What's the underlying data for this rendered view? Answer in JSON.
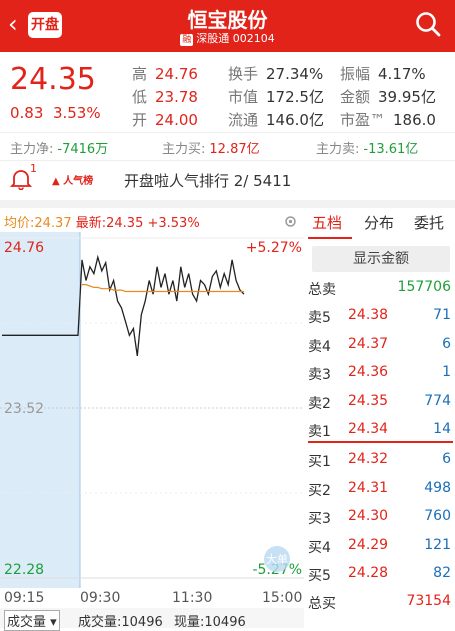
{
  "header": {
    "back": "‹",
    "logo": "开盘",
    "title": "恒宝股份",
    "tag": "融",
    "board": "深股通",
    "code": "002104"
  },
  "quote": {
    "price": "24.35",
    "change": "0.83",
    "change_pct": "3.53%"
  },
  "stats": [
    {
      "label": "高",
      "value": "24.76",
      "color": "#e2231a"
    },
    {
      "label": "换手",
      "value": "27.34%",
      "color": "#333333"
    },
    {
      "label": "振幅",
      "value": "4.17%",
      "color": "#333333"
    },
    {
      "label": "低",
      "value": "23.78",
      "color": "#e2231a"
    },
    {
      "label": "市值",
      "value": "172.5亿",
      "color": "#333333"
    },
    {
      "label": "金额",
      "value": "39.95亿",
      "color": "#333333"
    },
    {
      "label": "开",
      "value": "24.00",
      "color": "#e2231a"
    },
    {
      "label": "流通",
      "value": "146.0亿",
      "color": "#333333"
    },
    {
      "label": "市盈™",
      "value": "186.0",
      "color": "#333333"
    }
  ],
  "flow": [
    {
      "label": "主力净:",
      "value": "-7416万",
      "color": "#1e9f3a"
    },
    {
      "label": "主力买:",
      "value": "12.87亿",
      "color": "#e2231a"
    },
    {
      "label": "主力卖:",
      "value": "-13.61亿",
      "color": "#1e9f3a"
    }
  ],
  "notify": {
    "count": "1",
    "rank_icon": "人气榜",
    "rank_text": "开盘啦人气排行 2/ 5411"
  },
  "chart": {
    "avg_label": "均价:24.37",
    "latest_label": "最新:24.35 +3.53%",
    "y_top": "24.76",
    "y_mid": "23.52",
    "y_bot": "22.28",
    "pct_top": "+5.27%",
    "pct_bot": "-5.27%",
    "times": [
      "09:15",
      "09:30",
      "11:30",
      "15:00"
    ],
    "badge": "大单",
    "price_series": [
      24.05,
      24.05,
      24.05,
      24.05,
      24.05,
      24.05,
      24.05,
      24.05,
      24.05,
      24.6,
      24.45,
      24.55,
      24.5,
      24.62,
      24.52,
      24.58,
      24.38,
      24.45,
      24.3,
      24.25,
      24.15,
      24.05,
      24.1,
      23.9,
      24.2,
      24.3,
      24.45,
      24.35,
      24.55,
      24.4,
      24.5,
      24.35,
      24.45,
      24.3,
      24.55,
      24.4,
      24.5,
      24.35,
      24.3,
      24.45,
      24.42,
      24.35,
      24.48,
      24.52,
      24.4,
      24.5,
      24.42,
      24.6,
      24.45,
      24.38,
      24.35
    ],
    "avg_series": [
      24.42,
      24.42,
      24.41,
      24.4,
      24.4,
      24.39,
      24.39,
      24.39,
      24.38,
      24.38,
      24.38,
      24.37,
      24.37,
      24.37,
      24.37,
      24.37,
      24.37,
      24.37,
      24.37,
      24.37,
      24.37,
      24.37,
      24.37,
      24.37,
      24.37,
      24.37,
      24.37,
      24.37,
      24.37,
      24.37,
      24.37,
      24.37,
      24.37,
      24.37,
      24.37,
      24.37,
      24.37,
      24.37,
      24.37,
      24.37,
      24.37,
      24.37
    ],
    "ylim": [
      22.28,
      24.76
    ]
  },
  "volume": {
    "selector": "成交量",
    "vol_text": "成交量:10496",
    "now_text": "现量:10496"
  },
  "panel": {
    "tabs": [
      "五档",
      "分布",
      "委托"
    ],
    "show_amount": "显示金额",
    "total_sell_label": "总卖",
    "total_sell": "157706",
    "asks": [
      {
        "name": "卖5",
        "price": "24.38",
        "qty": "71"
      },
      {
        "name": "卖4",
        "price": "24.37",
        "qty": "6"
      },
      {
        "name": "卖3",
        "price": "24.36",
        "qty": "1"
      },
      {
        "name": "卖2",
        "price": "24.35",
        "qty": "774"
      },
      {
        "name": "卖1",
        "price": "24.34",
        "qty": "14"
      }
    ],
    "bids": [
      {
        "name": "买1",
        "price": "24.32",
        "qty": "6"
      },
      {
        "name": "买2",
        "price": "24.31",
        "qty": "498"
      },
      {
        "name": "买3",
        "price": "24.30",
        "qty": "760"
      },
      {
        "name": "买4",
        "price": "24.29",
        "qty": "121"
      },
      {
        "name": "买5",
        "price": "24.28",
        "qty": "82"
      }
    ],
    "total_buy_label": "总买",
    "total_buy": "73154"
  }
}
